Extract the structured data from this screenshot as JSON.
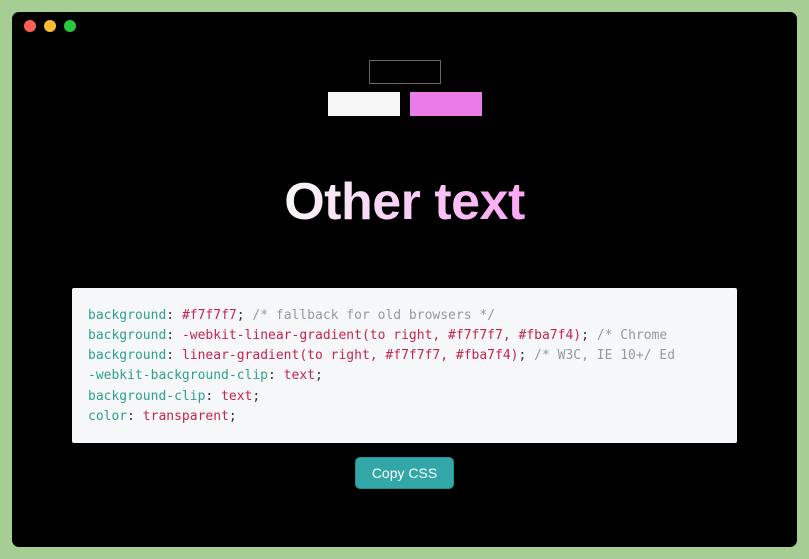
{
  "headline": "Other text",
  "swatches": {
    "outline": "#000000",
    "light": "#f7f7f7",
    "pink": "#ea7cea"
  },
  "gradient": {
    "from": "#f7f7f7",
    "to": "#fba7f4"
  },
  "code": {
    "l1_prop": "background",
    "l1_val": "#f7f7f7",
    "l1_comment": "/* fallback for old browsers */",
    "l2_prop": "background",
    "l2_val": "-webkit-linear-gradient(to right, #f7f7f7, #fba7f4)",
    "l2_comment": "/* Chrome ",
    "l3_prop": "background",
    "l3_val": "linear-gradient(to right, #f7f7f7, #fba7f4)",
    "l3_comment": "/* W3C, IE 10+/ Ed",
    "l4_prop": "-webkit-background-clip",
    "l4_val": "text",
    "l5_prop": "background-clip",
    "l5_val": "text",
    "l6_prop": "color",
    "l6_val": "transparent"
  },
  "buttons": {
    "copy": "Copy CSS"
  }
}
